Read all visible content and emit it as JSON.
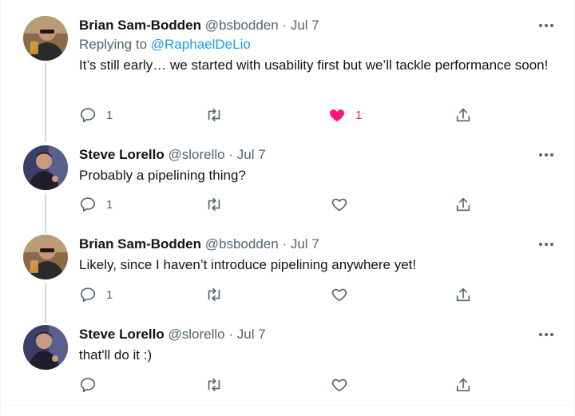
{
  "colors": {
    "text": "#0f1419",
    "secondary": "#536471",
    "link": "#1d9bf0",
    "like": "#f91880",
    "thread_line": "#cfd9de"
  },
  "tweets": [
    {
      "name": "Brian Sam-Bodden",
      "handle": "@bsbodden",
      "date": "· Jul 7",
      "reply_label": "Replying to",
      "reply_to": "@RaphaelDeLio",
      "text": "It’s still early… we started with usability first but we’ll tackle performance soon!",
      "reply_count": "1",
      "retweet_count": "",
      "like_count": "1",
      "liked": true
    },
    {
      "name": "Steve Lorello",
      "handle": "@slorello",
      "date": "· Jul 7",
      "text": "Probably a pipelining thing?",
      "reply_count": "1",
      "retweet_count": "",
      "like_count": "",
      "liked": false
    },
    {
      "name": "Brian Sam-Bodden",
      "handle": "@bsbodden",
      "date": "· Jul 7",
      "text": "Likely, since I haven’t introduce pipelining anywhere yet!",
      "reply_count": "1",
      "retweet_count": "",
      "like_count": "",
      "liked": false
    },
    {
      "name": "Steve Lorello",
      "handle": "@slorello",
      "date": "· Jul 7",
      "text": "that'll do it :)",
      "reply_count": "",
      "retweet_count": "",
      "like_count": "",
      "liked": false
    }
  ],
  "icons": {
    "reply": "reply-icon",
    "retweet": "retweet-icon",
    "like": "heart-icon",
    "share": "share-icon",
    "more": "more-icon"
  }
}
